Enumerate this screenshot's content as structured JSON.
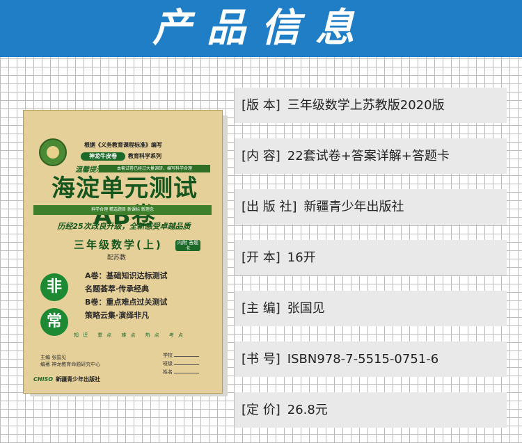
{
  "header": {
    "title": "产品信息"
  },
  "book": {
    "standard": "根据《义务教育课程标准》编写",
    "series_pill": "神龙牛皮卷",
    "series": "教育科学系列",
    "tag": "温馨提示",
    "ribbon": "本套试卷已经过大量调研，编写科学合理",
    "title": "海淀单元测试AB卷",
    "band": "科学合理 精选题目 新课标 新理念",
    "upgrade": "历经25次改良升级，全新感受卓越品质",
    "grade": "三年级数学(上)",
    "answer_badge": "内附 答题卡",
    "edition": "配苏教",
    "medal_1": "非",
    "medal_2": "常",
    "lines": [
      "A卷：基础知识达标测试",
      "名题荟萃·传承经典",
      "B卷：重点难点过关测试",
      "策略云集·演绎非凡"
    ],
    "keywords": "知识 重点 难点 热点 考点",
    "editor": "主编  张国见",
    "compiler": "编著  神龙教育命题研究中心",
    "fields": [
      "学校",
      "班级",
      "姓名"
    ],
    "publisher_logo": "CHISO",
    "publisher": "新疆青少年出版社"
  },
  "info": [
    {
      "key": "[版 本]",
      "value": "三年级数学上苏教版2020版"
    },
    {
      "key": "[内 容]",
      "value": "22套试卷+答案详解+答题卡"
    },
    {
      "key": "[出 版 社]",
      "value": "新疆青少年出版社"
    },
    {
      "key": "[开 本]",
      "value": "16开"
    },
    {
      "key": "[主 编]",
      "value": "张国见"
    },
    {
      "key": "[书 号]",
      "value": "ISBN978-7-5515-0751-6"
    },
    {
      "key": "[定 价]",
      "value": "26.8元"
    }
  ]
}
